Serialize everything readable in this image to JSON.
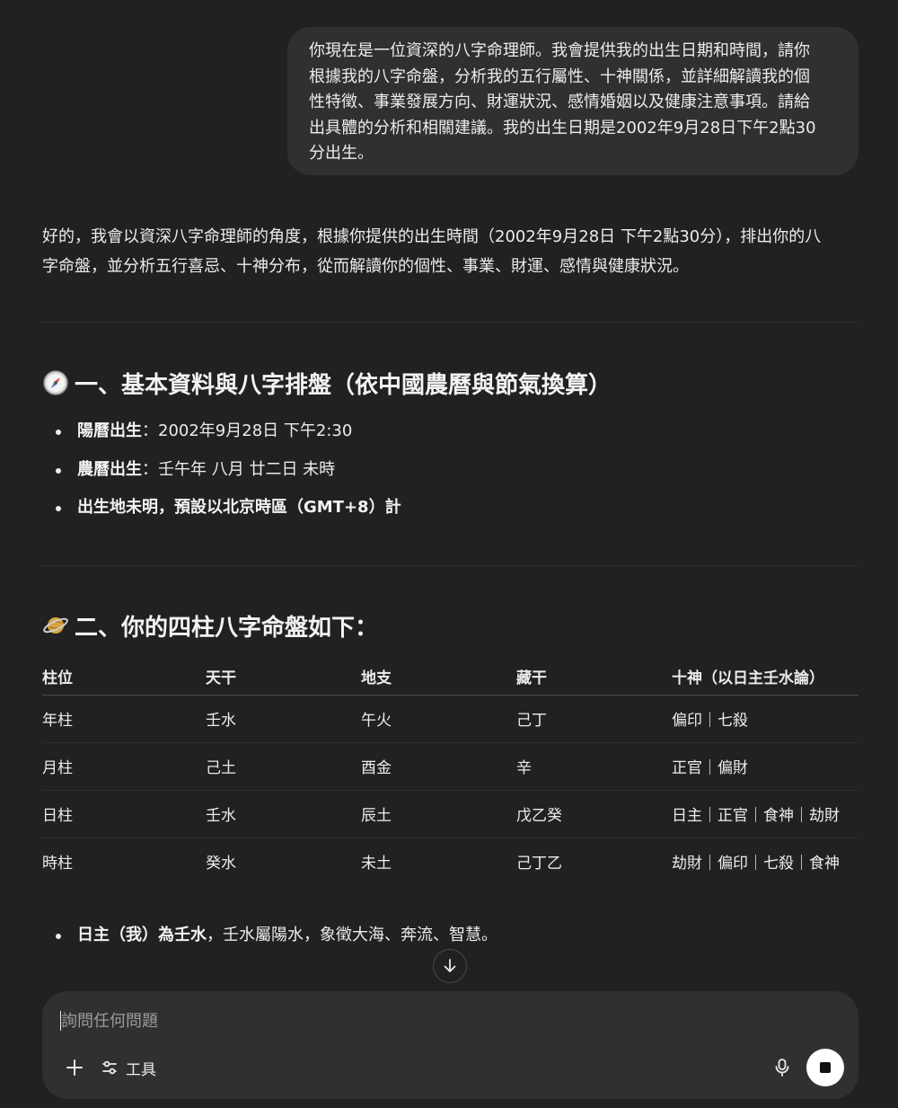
{
  "user_message": {
    "lines": [
      "你現在是一位資深的八字命理師。我會提供我的出生日期和時間，請你",
      "根據我的八字命盤，分析我的五行屬性、十神關係，並詳細解讀我的個",
      "性特徵、事業發展方向、財運狀況、感情婚姻以及健康注意事項。請給",
      "出具體的分析和相關建議。我的出生日期是2002年9月28日下午2點30",
      "分出生。"
    ]
  },
  "response": {
    "intro_lines": [
      "好的，我會以資深八字命理師的角度，根據你提供的出生時間（2002年9月28日 下午2點30分），排出你的八",
      "字命盤，並分析五行喜忌、十神分布，從而解讀你的個性、事業、財運、感情與健康狀況。"
    ],
    "section1": {
      "icon": "compass-emoji-icon",
      "title": "一、基本資料與八字排盤（依中國農曆與節氣換算）",
      "bullets": [
        {
          "label": "陽曆出生",
          "text": "：2002年9月28日 下午2:30"
        },
        {
          "label": "農曆出生",
          "text": "：壬午年 八月 廿二日 未時"
        },
        {
          "label": "出生地未明，預設以北京時區（GMT+8）計",
          "text": ""
        }
      ]
    },
    "section2": {
      "icon": "planet-emoji-icon",
      "title": "二、你的四柱八字命盤如下：",
      "table": {
        "headers": [
          "柱位",
          "天干",
          "地支",
          "藏干",
          "十神（以日主壬水論）"
        ],
        "rows": [
          [
            "年柱",
            "壬水",
            "午火",
            "己丁",
            "偏印｜七殺"
          ],
          [
            "月柱",
            "己土",
            "酉金",
            "辛",
            "正官｜偏財"
          ],
          [
            "日柱",
            "壬水",
            "辰土",
            "戊乙癸",
            "日主｜正官｜食神｜劫財"
          ],
          [
            "時柱",
            "癸水",
            "未土",
            "己丁乙",
            "劫財｜偏印｜七殺｜食神"
          ]
        ]
      },
      "bullet": {
        "label": "日主（我）為壬水",
        "text": "，壬水屬陽水，象徵大海、奔流、智慧。"
      }
    }
  },
  "composer": {
    "placeholder": "詢問任何問題",
    "tools_label": "工具"
  }
}
